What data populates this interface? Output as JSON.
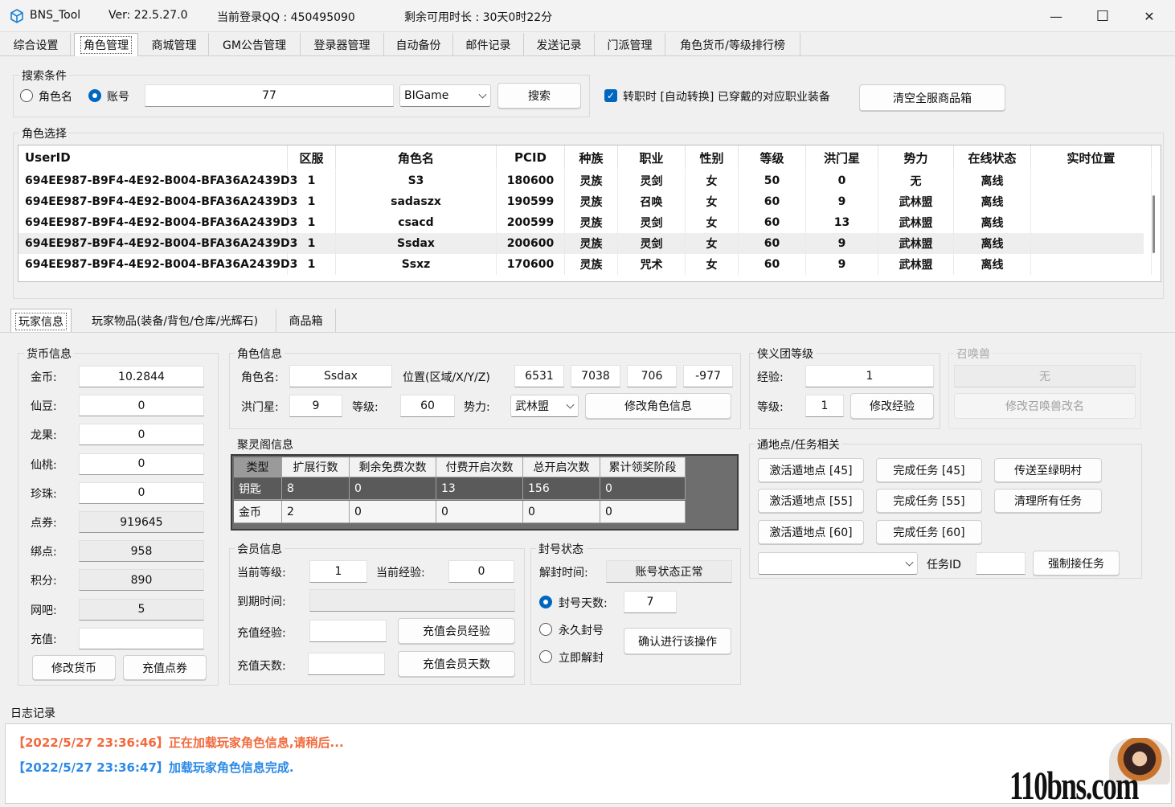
{
  "titlebar": {
    "app_name": "BNS_Tool",
    "version": "Ver:  22.5.27.0",
    "login_qq": "当前登录QQ : 450495090",
    "remaining": "剩余可用时长 : 30天0时22分",
    "minimize": "—",
    "maximize": "☐",
    "close": "✕"
  },
  "tabs": [
    "综合设置",
    "角色管理",
    "商城管理",
    "GM公告管理",
    "登录器管理",
    "自动备份",
    "邮件记录",
    "发送记录",
    "门派管理",
    "角色货币/等级排行榜"
  ],
  "search": {
    "title": "搜索条件",
    "radio_name": "角色名",
    "radio_account": "账号",
    "value": "77",
    "db_select": "BIGame",
    "search_btn": "搜索"
  },
  "auto_switch": {
    "label": "转职时 [自动转换] 已穿戴的对应职业装备"
  },
  "clear_btn": "清空全服商品箱",
  "role_select": {
    "title": "角色选择",
    "headers": [
      "UserID",
      "区服",
      "角色名",
      "PCID",
      "种族",
      "职业",
      "性别",
      "等级",
      "洪门星",
      "势力",
      "在线状态",
      "实时位置"
    ],
    "rows": [
      [
        "694EE987-B9F4-4E92-B004-BFA36A2439D3",
        "1",
        "S3",
        "180600",
        "灵族",
        "灵剑",
        "女",
        "50",
        "0",
        "无",
        "离线",
        ""
      ],
      [
        "694EE987-B9F4-4E92-B004-BFA36A2439D3",
        "1",
        "sadaszx",
        "190599",
        "灵族",
        "召唤",
        "女",
        "60",
        "9",
        "武林盟",
        "离线",
        ""
      ],
      [
        "694EE987-B9F4-4E92-B004-BFA36A2439D3",
        "1",
        "csacd",
        "200599",
        "灵族",
        "灵剑",
        "女",
        "60",
        "13",
        "武林盟",
        "离线",
        ""
      ],
      [
        "694EE987-B9F4-4E92-B004-BFA36A2439D3",
        "1",
        "Ssdax",
        "200600",
        "灵族",
        "灵剑",
        "女",
        "60",
        "9",
        "武林盟",
        "离线",
        ""
      ],
      [
        "694EE987-B9F4-4E92-B004-BFA36A2439D3",
        "1",
        "Ssxz",
        "170600",
        "灵族",
        "咒术",
        "女",
        "60",
        "9",
        "武林盟",
        "离线",
        ""
      ]
    ]
  },
  "subtabs": [
    "玩家信息",
    "玩家物品(装备/背包/仓库/光辉石)",
    "商品箱"
  ],
  "currency": {
    "title": "货币信息",
    "items": [
      {
        "label": "金币:",
        "value": "10.2844"
      },
      {
        "label": "仙豆:",
        "value": "0"
      },
      {
        "label": "龙果:",
        "value": "0"
      },
      {
        "label": "仙桃:",
        "value": "0"
      },
      {
        "label": "珍珠:",
        "value": "0"
      },
      {
        "label": "点券:",
        "value": "919645"
      },
      {
        "label": "绑点:",
        "value": "958"
      },
      {
        "label": "积分:",
        "value": "890"
      },
      {
        "label": "网吧:",
        "value": "5"
      },
      {
        "label": "充值:",
        "value": ""
      }
    ],
    "modify_btn": "修改货币",
    "recharge_btn": "充值点券"
  },
  "role_info": {
    "title": "角色信息",
    "name_label": "角色名:",
    "name_value": "Ssdax",
    "pos_label": "位置(区域/X/Y/Z)",
    "pos_values": [
      "6531",
      "7038",
      "706",
      "-977"
    ],
    "star_label": "洪门星:",
    "star_value": "9",
    "level_label": "等级:",
    "level_value": "60",
    "faction_label": "势力:",
    "faction_value": "武林盟",
    "modify_btn": "修改角色信息"
  },
  "guild": {
    "title": "侠义团等级",
    "exp_label": "经验:",
    "exp_value": "1",
    "lvl_label": "等级:",
    "lvl_value": "1",
    "modify_btn": "修改经验"
  },
  "summon": {
    "title": "召唤兽",
    "value": "无",
    "rename_btn": "修改召唤兽改名"
  },
  "jlg": {
    "title": "聚灵阁信息",
    "headers": [
      "类型",
      "扩展行数",
      "剩余免费次数",
      "付费开启次数",
      "总开启次数",
      "累计领奖阶段"
    ],
    "rows": [
      [
        "钥匙",
        "8",
        "0",
        "13",
        "156",
        "0"
      ],
      [
        "金币",
        "2",
        "0",
        "0",
        "0",
        "0"
      ]
    ]
  },
  "teleport": {
    "title": "通地点/任务相关",
    "buttons": [
      [
        "激活遁地点 [45]",
        "完成任务 [45]",
        "传送至绿明村"
      ],
      [
        "激活遁地点 [55]",
        "完成任务 [55]",
        "清理所有任务"
      ],
      [
        "激活遁地点 [60]",
        "完成任务 [60]"
      ]
    ],
    "task_id_label": "任务ID",
    "force_btn": "强制接任务"
  },
  "member": {
    "title": "会员信息",
    "cur_level_label": "当前等级:",
    "cur_level_value": "1",
    "cur_exp_label": "当前经验:",
    "cur_exp_value": "0",
    "expire_label": "到期时间:",
    "recharge_exp_label": "充值经验:",
    "recharge_exp_btn": "充值会员经验",
    "recharge_days_label": "充值天数:",
    "recharge_days_btn": "充值会员天数"
  },
  "ban": {
    "title": "封号状态",
    "unban_label": "解封时间:",
    "status_value": "账号状态正常",
    "days_label": "封号天数:",
    "days_value": "7",
    "perm_label": "永久封号",
    "now_label": "立即解封",
    "confirm_btn": "确认进行该操作"
  },
  "log": {
    "title": "日志记录",
    "lines": [
      {
        "text": "【2022/5/27 23:36:46】正在加载玩家角色信息,请稍后...",
        "color": "#f26a3d"
      },
      {
        "text": "【2022/5/27 23:36:47】加载玩家角色信息完成.",
        "color": "#2b8ae6"
      }
    ]
  },
  "watermark": "110bns.com"
}
